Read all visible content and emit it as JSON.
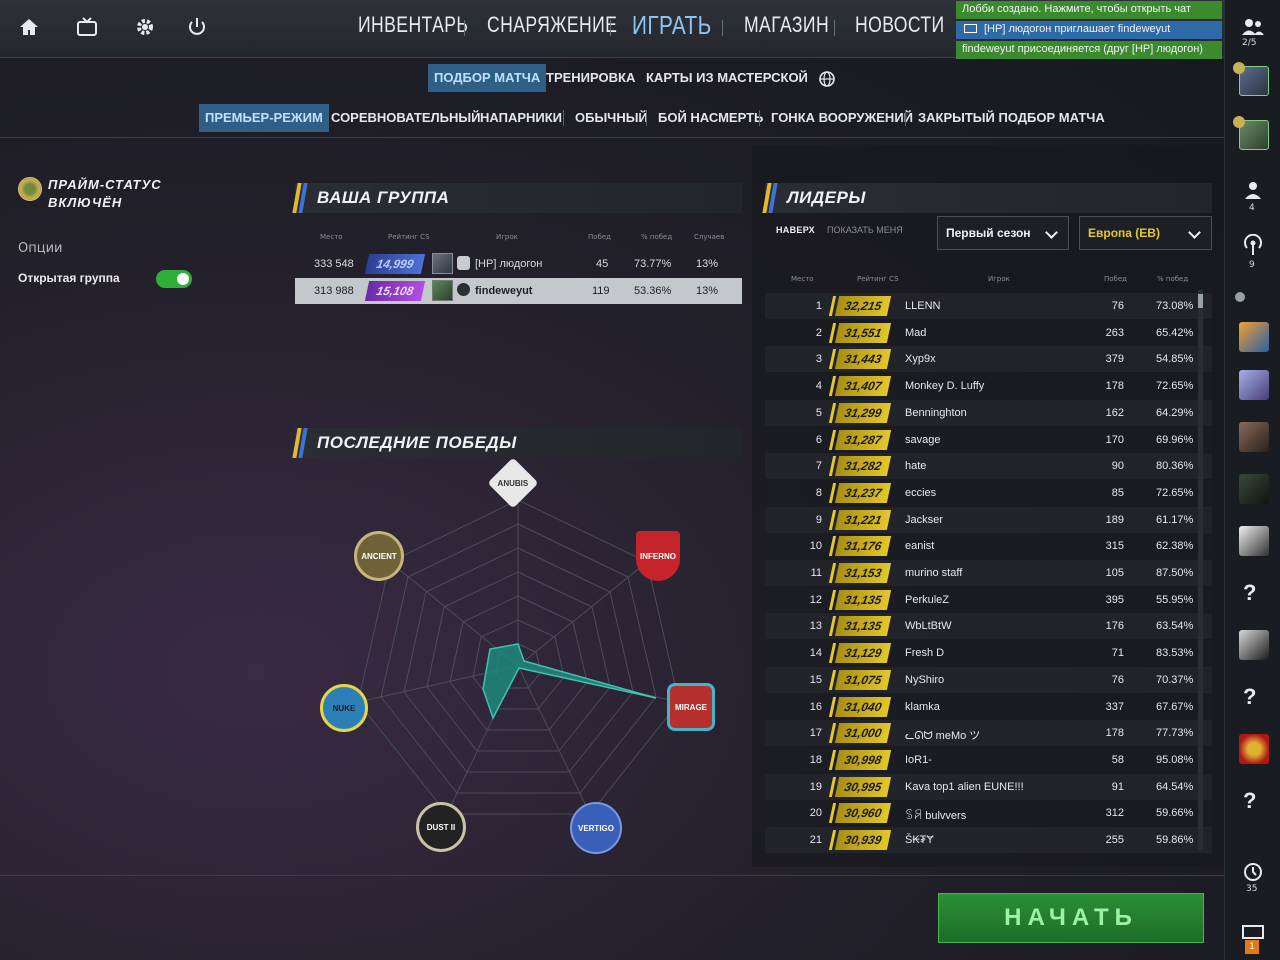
{
  "topbar": {
    "nav": [
      "ИНВЕНТАРЬ",
      "СНАРЯЖЕНИЕ",
      "ИГРАТЬ",
      "МАГАЗИН",
      "НОВОСТИ"
    ],
    "notifications": [
      "Лобби создано. Нажмите, чтобы открыть чат",
      "[HP] людогон приглашает findeweyut",
      "findeweyut присоединяется (друг [HP] людогон)"
    ]
  },
  "submenu_play": [
    "ПОДБОР МАТЧА",
    "ТРЕНИРОВКА",
    "КАРТЫ ИЗ МАСТЕРСКОЙ"
  ],
  "submenu_modes": [
    "ПРЕМЬЕР-РЕЖИМ",
    "СОРЕВНОВАТЕЛЬНЫЙ",
    "НАПАРНИКИ",
    "ОБЫЧНЫЙ",
    "БОЙ НАСМЕРТЬ",
    "ГОНКА ВООРУЖЕНИЙ",
    "ЗАКРЫТЫЙ ПОДБОР МАТЧА"
  ],
  "left": {
    "prime_line1": "ПРАЙМ-СТАТУС",
    "prime_line2": "ВКЛЮЧЁН",
    "options_label": "Опции",
    "open_group_label": "Открытая группа",
    "open_group_on": true
  },
  "group": {
    "title": "ВАША ГРУППА",
    "headers": [
      "Место",
      "Рейтинг CS",
      "Игрок",
      "Побед",
      "% побед",
      "Случаев"
    ],
    "rows": [
      {
        "place": "333 548",
        "rating": "14,999",
        "player": "[HP] людогон",
        "wins": "45",
        "winrate": "73.77%",
        "cases": "13%"
      },
      {
        "place": "313 988",
        "rating": "15,108",
        "player": "findeweyut",
        "wins": "119",
        "winrate": "53.36%",
        "cases": "13%"
      }
    ]
  },
  "wins": {
    "title": "ПОСЛЕДНИЕ ПОБЕДЫ",
    "maps": [
      "ANUBIS",
      "INFERNO",
      "MIRAGE",
      "VERTIGO",
      "DUST II",
      "NUKE",
      "ANCIENT"
    ]
  },
  "leaders": {
    "title": "ЛИДЕРЫ",
    "tab_top": "НАВЕРХ",
    "tab_me": "ПОКАЗАТЬ МЕНЯ",
    "season": "Первый сезон",
    "region": "Европа (ЕВ)",
    "headers": [
      "Место",
      "Рейтинг CS",
      "Игрок",
      "Побед",
      "% побед"
    ],
    "rows": [
      {
        "place": "1",
        "rating": "32,215",
        "player": "LLENN",
        "wins": "76",
        "winrate": "73.08%"
      },
      {
        "place": "2",
        "rating": "31,551",
        "player": "Mad",
        "wins": "263",
        "winrate": "65.42%"
      },
      {
        "place": "3",
        "rating": "31,443",
        "player": "Xyp9x",
        "wins": "379",
        "winrate": "54.85%"
      },
      {
        "place": "4",
        "rating": "31,407",
        "player": "Monkey D. Luffy",
        "wins": "178",
        "winrate": "72.65%"
      },
      {
        "place": "5",
        "rating": "31,299",
        "player": "Benninghton",
        "wins": "162",
        "winrate": "64.29%"
      },
      {
        "place": "6",
        "rating": "31,287",
        "player": "savage",
        "wins": "170",
        "winrate": "69.96%"
      },
      {
        "place": "7",
        "rating": "31,282",
        "player": "hate",
        "wins": "90",
        "winrate": "80.36%"
      },
      {
        "place": "8",
        "rating": "31,237",
        "player": "eccies",
        "wins": "85",
        "winrate": "72.65%"
      },
      {
        "place": "9",
        "rating": "31,221",
        "player": "Jackser",
        "wins": "189",
        "winrate": "61.17%"
      },
      {
        "place": "10",
        "rating": "31,176",
        "player": "eanist",
        "wins": "315",
        "winrate": "62.38%"
      },
      {
        "place": "11",
        "rating": "31,153",
        "player": "murino staff",
        "wins": "105",
        "winrate": "87.50%"
      },
      {
        "place": "12",
        "rating": "31,135",
        "player": "PerkuleZ",
        "wins": "395",
        "winrate": "55.95%"
      },
      {
        "place": "13",
        "rating": "31,135",
        "player": "WbLtBtW",
        "wins": "176",
        "winrate": "63.54%"
      },
      {
        "place": "14",
        "rating": "31,129",
        "player": "Fresh D",
        "wins": "71",
        "winrate": "83.53%"
      },
      {
        "place": "15",
        "rating": "31,075",
        "player": "NyShiro",
        "wins": "76",
        "winrate": "70.37%"
      },
      {
        "place": "16",
        "rating": "31,040",
        "player": "klamka",
        "wins": "337",
        "winrate": "67.67%"
      },
      {
        "place": "17",
        "rating": "31,000",
        "player": "ᓚᘏᗢ meMo ツ",
        "wins": "178",
        "winrate": "77.73%"
      },
      {
        "place": "18",
        "rating": "30,998",
        "player": "IoR1-",
        "wins": "58",
        "winrate": "95.08%"
      },
      {
        "place": "19",
        "rating": "30,995",
        "player": "Kava top1 alien EUNE!!!",
        "wins": "91",
        "winrate": "64.54%"
      },
      {
        "place": "20",
        "rating": "30,960",
        "player": "ꌗꋪ bulvvers",
        "wins": "312",
        "winrate": "59.66%"
      },
      {
        "place": "21",
        "rating": "30,939",
        "player": "Š₭₮Ɏ",
        "wins": "255",
        "winrate": "59.86%"
      }
    ]
  },
  "start_button": "НАЧАТЬ",
  "sidebar": {
    "friends_count": "2/5",
    "count_4": "4",
    "count_9": "9",
    "history_count": "35",
    "mail_count": "1"
  },
  "colors": {
    "accent_blue": "#2f5f86",
    "rating_gold": "#e3c72c",
    "start_green": "#2b8f35",
    "radar_fill": "#1f8a7a"
  }
}
